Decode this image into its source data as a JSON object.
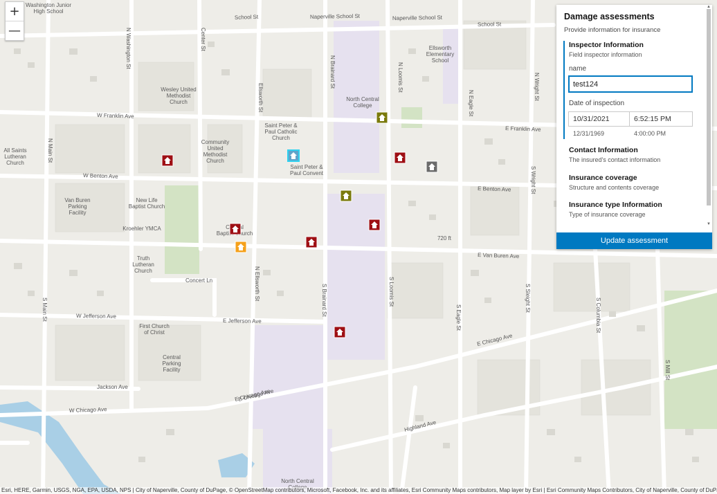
{
  "map": {
    "zoom_in": "+",
    "zoom_out": "—",
    "street_labels": [
      "School St",
      "Naperville School St",
      "Naperville School St",
      "School St",
      "W Franklin Ave",
      "E Franklin Ave",
      "W Benton Ave",
      "E Benton Ave",
      "E Van Buren Ave",
      "Concert Ln",
      "W Jefferson Ave",
      "E Jefferson Ave",
      "W Chicago Ave",
      "E Chicago Ave",
      "E Chicago Ave",
      "Jackson Ave",
      "Highland Ave",
      "N Washington St",
      "Center St",
      "Ellsworth St",
      "N Brainard St",
      "N Loomis St",
      "N Eagle St",
      "N Wright St",
      "S Wright St",
      "S Eagle St",
      "S Loomis St",
      "S Brainard St",
      "S Main St",
      "N Main St",
      "S Mill St",
      "S Columbia St",
      "S Sleight St",
      "E Chicago Ave",
      "N Ellsworth St"
    ],
    "place_labels": [
      "Washington Junior High School",
      "Wesley United Methodist Church",
      "North Central College",
      "Ellsworth Elementary School",
      "Saint Peter & Paul Catholic Church",
      "Community United Methodist Church",
      "Saint Peter & Paul Convent",
      "All Saints Lutheran Church",
      "Van Buren Parking Facility",
      "New Life Baptist Church",
      "Kroehler YMCA",
      "Central Baptist Church",
      "Truth Lutheran Church",
      "First Church of Christ",
      "Central Parking Facility",
      "North Central College",
      "720 ft"
    ],
    "markers": [
      {
        "severity": "destroyed",
        "color": "#9e0f14"
      },
      {
        "severity": "destroyed",
        "color": "#9e0f14"
      },
      {
        "severity": "destroyed",
        "color": "#9e0f14"
      },
      {
        "severity": "destroyed",
        "color": "#9e0f14"
      },
      {
        "severity": "destroyed",
        "color": "#9e0f14"
      },
      {
        "severity": "destroyed",
        "color": "#9e0f14"
      },
      {
        "severity": "minor",
        "color": "#7a7a0c"
      },
      {
        "severity": "minor",
        "color": "#7a7a0c"
      },
      {
        "severity": "affected",
        "color": "#f5a11b"
      },
      {
        "severity": "unknown",
        "color": "#6b6b6b"
      },
      {
        "severity": "selected",
        "color": "#61a3c9"
      }
    ]
  },
  "panel": {
    "title": "Damage assessments",
    "subtitle": "Provide information for insurance",
    "groups": [
      {
        "title": "Inspector Information",
        "description": "Field inspector information"
      },
      {
        "title": "Contact Information",
        "description": "The insured's contact information"
      },
      {
        "title": "Insurance coverage",
        "description": "Structure and contents coverage"
      },
      {
        "title": "Insurance type Information",
        "description": "Type of insurance coverage"
      }
    ],
    "name_label": "name",
    "name_value": "test124",
    "date_label": "Date of inspection",
    "date_value": "10/31/2021",
    "time_value": "6:52:15 PM",
    "date_hint": "12/31/1969",
    "time_hint": "4:00:00 PM",
    "update_button": "Update assessment"
  },
  "attribution": "Esri, HERE, Garmin, USGS, NGA, EPA, USDA, NPS | City of Naperville, County of DuPage, © OpenStreetMap contributors, Microsoft, Facebook, Inc. and its affiliates, Esri Community Maps contributors, Map layer by Esri | Esri Community Maps Contributors, City of Naperville, County of DuPage, © OpenStreetMap, Microsoft, Esri, HERE, Garmin, SafeGraph, INCREMENT P, METI/NASA, USGS, EPA, NPS, US Census Bureau, USDA",
  "colors": {
    "accent": "#0079c1",
    "road": "#ffffff",
    "land": "#eeede8",
    "campus": "#e6e1ef",
    "park": "#d3e3c4",
    "water": "#a9cfe6"
  }
}
